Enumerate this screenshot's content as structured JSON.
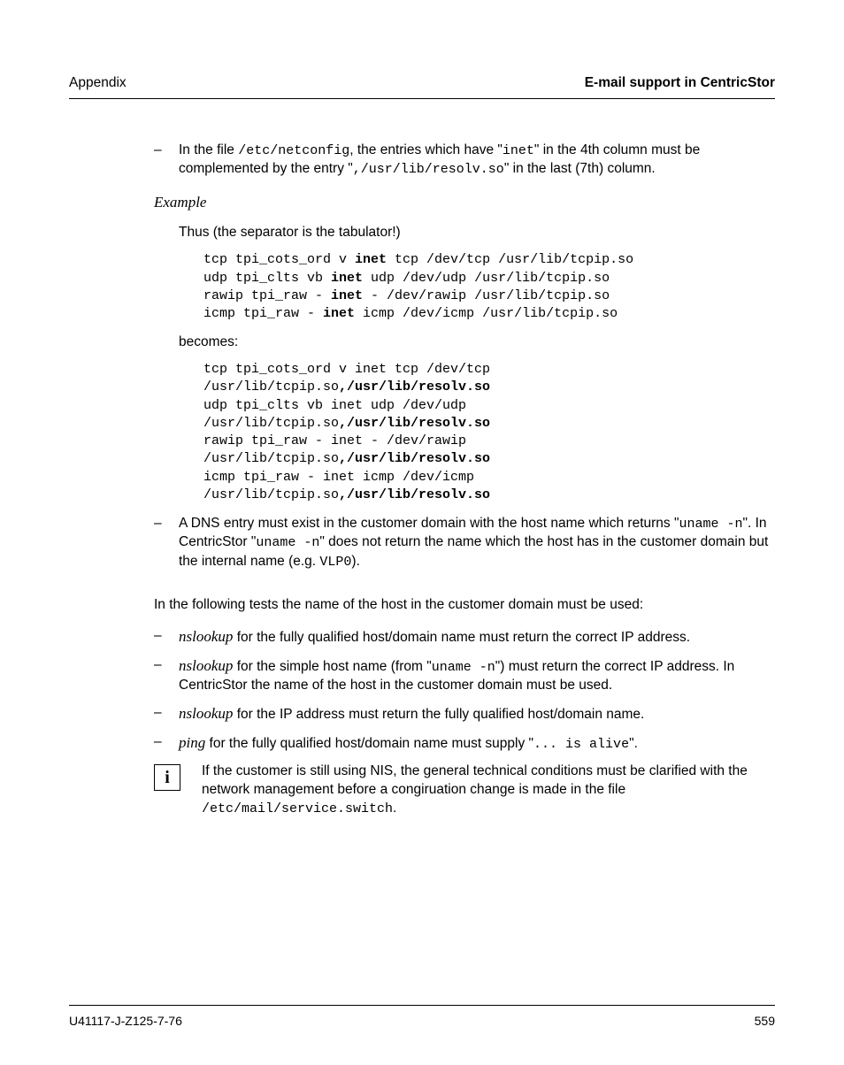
{
  "header": {
    "left": "Appendix",
    "right": "E-mail support in CentricStor"
  },
  "bullet1": {
    "dash": "–",
    "pre1": "In the file ",
    "code1": "/etc/netconfig",
    "mid1": ", the entries which have \"",
    "code2": "inet",
    "mid2": "\" in the 4th column must be complemented by the entry \"",
    "code3": ",/usr/lib/resolv.so",
    "post": "\" in the last (7th) column."
  },
  "example_label": "Example",
  "thus_line": "Thus (the separator is the tabulator!)",
  "code_block1": "tcp tpi_cots_ord v inet tcp /dev/tcp /usr/lib/tcpip.so\nudp tpi_clts vb inet udp /dev/udp /usr/lib/tcpip.so\nrawip tpi_raw - inet - /dev/rawip /usr/lib/tcpip.so\nicmp tpi_raw - inet icmp /dev/icmp /usr/lib/tcpip.so",
  "code1_lines": [
    {
      "pre": "tcp tpi_cots_ord v ",
      "b": "inet",
      "post": " tcp /dev/tcp /usr/lib/tcpip.so"
    },
    {
      "pre": "udp tpi_clts vb ",
      "b": "inet",
      "post": " udp /dev/udp /usr/lib/tcpip.so"
    },
    {
      "pre": "rawip tpi_raw - ",
      "b": "inet",
      "post": " - /dev/rawip /usr/lib/tcpip.so"
    },
    {
      "pre": "icmp tpi_raw - ",
      "b": "inet",
      "post": " icmp /dev/icmp /usr/lib/tcpip.so"
    }
  ],
  "becomes": "becomes:",
  "code2_lines": [
    {
      "pre": "tcp tpi_cots_ord v inet tcp /dev/tcp",
      "b": ""
    },
    {
      "pre": "/usr/lib/tcpip.so",
      "b": ",/usr/lib/resolv.so"
    },
    {
      "pre": "udp tpi_clts vb inet udp /dev/udp",
      "b": ""
    },
    {
      "pre": "/usr/lib/tcpip.so",
      "b": ",/usr/lib/resolv.so"
    },
    {
      "pre": "rawip tpi_raw - inet - /dev/rawip",
      "b": ""
    },
    {
      "pre": "/usr/lib/tcpip.so",
      "b": ",/usr/lib/resolv.so"
    },
    {
      "pre": "icmp tpi_raw - inet icmp /dev/icmp",
      "b": ""
    },
    {
      "pre": "/usr/lib/tcpip.so",
      "b": ",/usr/lib/resolv.so"
    }
  ],
  "bullet2": {
    "dash": "–",
    "pre1": "A DNS entry must exist in the customer domain with the host name which returns \"",
    "code1": "uname -n",
    "mid1": "\". In CentricStor \"",
    "code2": "uname -n",
    "mid2": "\" does not return the name which the host has in the customer domain but the internal name (e.g. ",
    "code3": "VLP0",
    "post": ")."
  },
  "tests_intro": "In the following tests the name of the host in the customer domain must be used:",
  "test_items": [
    {
      "dash": "–",
      "i": "nslookup",
      "t": " for the fully qualified host/domain name must return the correct IP address."
    },
    {
      "dash": "–",
      "i": "nslookup",
      "t_pre": " for the simple host name (from \"",
      "code": "uname -n",
      "t_post": "\") must return the correct IP address. In CentricStor the name of the host in the customer domain must be used."
    },
    {
      "dash": "–",
      "i": "nslookup",
      "t": " for the IP address must return the fully qualified host/domain name."
    },
    {
      "dash": "–",
      "i": "ping",
      "t_pre": " for the fully qualified host/domain name must supply \"",
      "code": "... is alive",
      "t_post": "\"."
    }
  ],
  "info": {
    "icon": "i",
    "text_pre": "If the customer is still using NIS, the general technical conditions must be clarified with the network management before a congiruation change is made in the file ",
    "code": "/etc/mail/service.switch",
    "text_post": "."
  },
  "footer": {
    "left": "U41117-J-Z125-7-76",
    "right": "559"
  }
}
